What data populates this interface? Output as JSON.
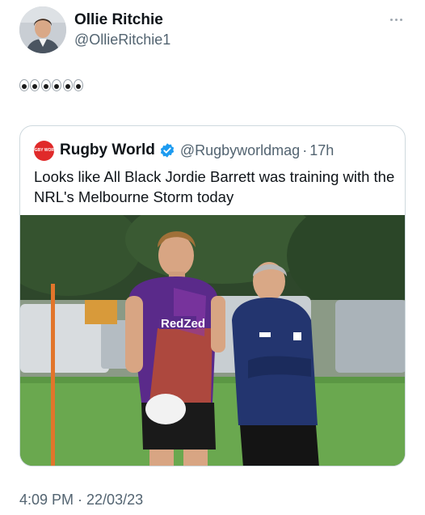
{
  "tweet": {
    "author_name": "Ollie Ritchie",
    "author_handle": "@OllieRitchie1",
    "text_emoji": [
      "eyes",
      "eyes",
      "eyes"
    ],
    "timestamp": "4:09 PM · 22/03/23",
    "avatar_icon": "profile-photo"
  },
  "quoted": {
    "logo_text": "RUGBY WORLD",
    "name": "Rugby World",
    "verified": true,
    "handle": "@Rugbyworldmag",
    "separator": "·",
    "time": "17h",
    "text": "Looks like All Black Jordie Barrett was training with the NRL's Melbourne Storm today",
    "photo": {
      "shirt_sponsor": "RedZed",
      "colors": {
        "jersey": "#5a2a8a",
        "jacket": "#23356f",
        "grass": "#6aa84f",
        "trees": "#2d4a2a"
      }
    }
  },
  "colors": {
    "text_primary": "#0f1419",
    "text_secondary": "#536471",
    "border": "#cfd9de",
    "verified_blue": "#1d9bf0",
    "logo_red": "#e02a2a"
  }
}
